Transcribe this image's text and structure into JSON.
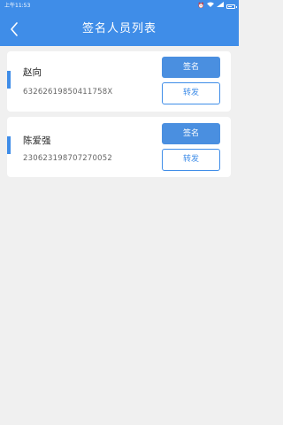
{
  "status_bar": {
    "time": "上午11:53",
    "icons": [
      "alarm-icon",
      "wifi-icon",
      "signal-icon",
      "battery-icon"
    ],
    "battery_level": 0.7
  },
  "header": {
    "title": "签名人员列表",
    "back_icon": "chevron-left-icon"
  },
  "people": [
    {
      "name": "赵向",
      "id_number": "63262619850411758X",
      "sign_label": "签名",
      "forward_label": "转发"
    },
    {
      "name": "陈爱强",
      "id_number": "230623198707270052",
      "sign_label": "签名",
      "forward_label": "转发"
    }
  ],
  "colors": {
    "primary": "#3f8de8",
    "background": "#f0f0f0",
    "card": "#ffffff"
  }
}
